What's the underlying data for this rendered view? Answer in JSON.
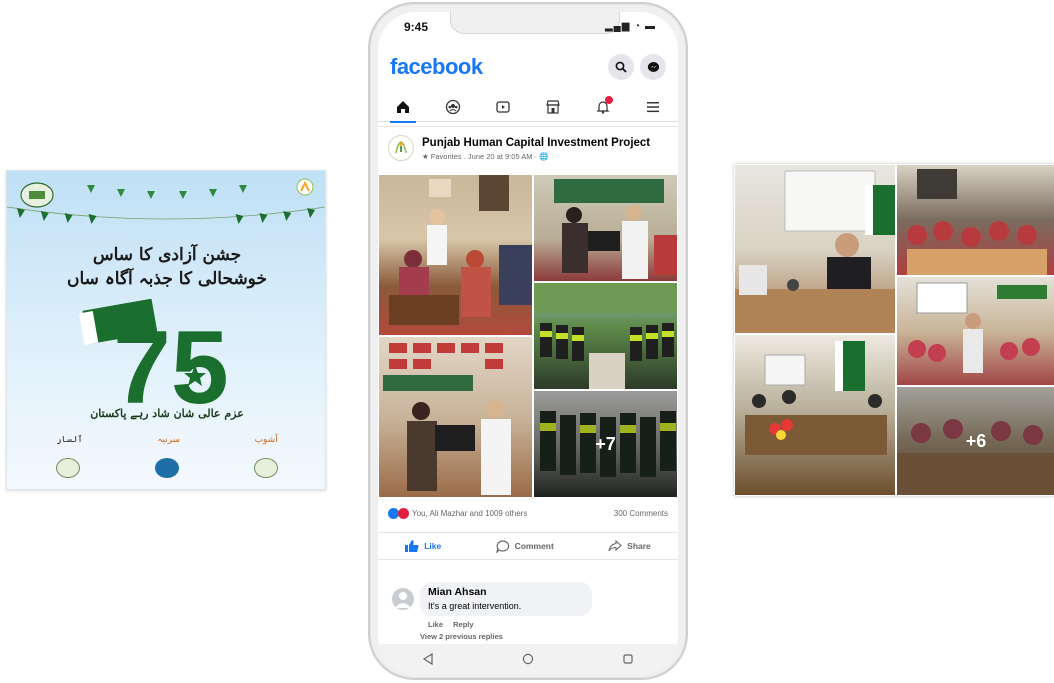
{
  "poster": {
    "urdu_title_line1": "جشن آزادی کا ساس",
    "urdu_title_line2": "خوشحالی کا جذبہ آگاہ ساں",
    "big_number": "75",
    "urdu_subtitle": "عزم عالی شان شاد رہے پاکستان",
    "sponsors": [
      "ٱلسار",
      "سرنیہ",
      "آشوب"
    ],
    "colors": {
      "green": "#1b6f2e",
      "sky": "#bfe0f6"
    }
  },
  "phone": {
    "status_time": "9:45",
    "app_name": "facebook",
    "nav_icons": [
      "home-icon",
      "groups-icon",
      "video-icon",
      "marketplace-icon",
      "notifications-icon",
      "menu-icon"
    ],
    "post": {
      "page_name": "Punjab Human Capital Investment Project",
      "meta": "★ Favorites . June 20 at 9:05 AM · 🌐",
      "more_photos": "+7",
      "reactions_text": "You, Ali Mazhar and 1009 others",
      "comments_count": "300 Comments",
      "actions": {
        "like": "Like",
        "comment": "Comment",
        "share": "Share"
      }
    },
    "comment": {
      "author": "Mian Ahsan",
      "text": "It's a great intervention.",
      "like": "Like",
      "reply": "Reply",
      "previous": "View 2 previous replies"
    },
    "colors": {
      "fb_blue": "#1877f2",
      "notification_red": "#e41e3f"
    }
  },
  "collage": {
    "more_photos": "+6"
  }
}
